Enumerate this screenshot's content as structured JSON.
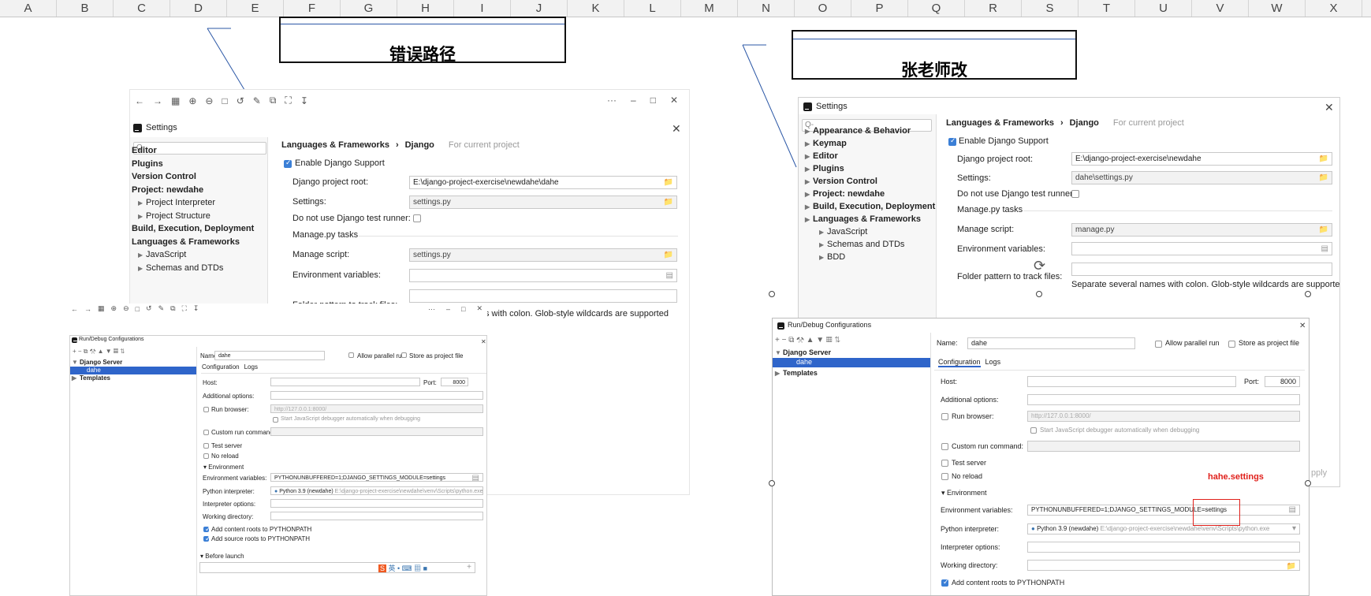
{
  "columns": [
    "A",
    "B",
    "C",
    "D",
    "E",
    "F",
    "G",
    "H",
    "I",
    "J",
    "K",
    "L",
    "M",
    "N",
    "O",
    "P",
    "Q",
    "R",
    "S",
    "T",
    "U",
    "V",
    "W",
    "X"
  ],
  "callouts": {
    "left": "错误路径",
    "right": "张老师改"
  },
  "left_settings": {
    "title": "Settings",
    "search_placeholder": "Q-",
    "breadcrumb": {
      "section": "Languages & Frameworks",
      "page": "Django",
      "scope": "For current project"
    },
    "tree": [
      {
        "label": "Editor",
        "bold": true
      },
      {
        "label": "Plugins",
        "bold": true
      },
      {
        "label": "Version Control",
        "bold": true
      },
      {
        "label": "Project: newdahe",
        "bold": true
      },
      {
        "label": "Project Interpreter",
        "bold": false
      },
      {
        "label": "Project Structure",
        "bold": false
      },
      {
        "label": "Build, Execution, Deployment",
        "bold": true
      },
      {
        "label": "Languages & Frameworks",
        "bold": true
      },
      {
        "label": "JavaScript",
        "bold": false
      },
      {
        "label": "Schemas and DTDs",
        "bold": false
      }
    ],
    "enable_label": "Enable Django Support",
    "project_root_label": "Django project root:",
    "project_root_value": "E:\\django-project-exercise\\newdahe\\dahe",
    "settings_label": "Settings:",
    "settings_value": "settings.py",
    "no_test_runner_label": "Do not use Django test runner:",
    "manage_tasks": "Manage.py tasks",
    "manage_script_label": "Manage script:",
    "manage_script_value": "settings.py",
    "env_vars_label": "Environment variables:",
    "folder_pattern_label": "Folder pattern to track files:",
    "hint": "s with colon. Glob-style wildcards are supported"
  },
  "left_rundebug": {
    "title": "Run/Debug Configurations",
    "name_label": "Name:",
    "name_value": "dahe",
    "allow_parallel": "Allow parallel run",
    "store_as_file": "Store as project file",
    "tree_server": "Django Server",
    "tree_dahe": "dahe",
    "tree_templates": "Templates",
    "tab_config": "Configuration",
    "tab_logs": "Logs",
    "host": "Host:",
    "port": "Port:",
    "port_value": "8000",
    "additional": "Additional options:",
    "run_browser": "Run browser:",
    "run_browser_url": "http://127.0.0.1:8000/",
    "js_debugger": "Start JavaScript debugger automatically when debugging",
    "custom_cmd": "Custom run command:",
    "test_server": "Test server",
    "no_reload": "No reload",
    "environment": "Environment",
    "env_vars": "Environment variables:",
    "env_vars_value": "PYTHONUNBUFFERED=1;DJANGO_SETTINGS_MODULE=settings",
    "py_interp": "Python interpreter:",
    "py_interp_value": "Python 3.9 (newdahe)",
    "py_interp_path": "E:\\django-project-exercise\\newdahe\\venv\\Scripts\\python.exe",
    "interp_opts": "Interpreter options:",
    "work_dir": "Working directory:",
    "add_content": "Add content roots to PYTHONPATH",
    "add_source": "Add source roots to PYTHONPATH",
    "before_launch": "Before launch"
  },
  "right_settings": {
    "title": "Settings",
    "search_placeholder": "Q-",
    "breadcrumb": {
      "section": "Languages & Frameworks",
      "page": "Django",
      "scope": "For current project"
    },
    "tree": [
      {
        "label": "Appearance & Behavior",
        "bold": true
      },
      {
        "label": "Keymap",
        "bold": true
      },
      {
        "label": "Editor",
        "bold": true
      },
      {
        "label": "Plugins",
        "bold": true
      },
      {
        "label": "Version Control",
        "bold": true
      },
      {
        "label": "Project: newdahe",
        "bold": true
      },
      {
        "label": "Build, Execution, Deployment",
        "bold": true
      },
      {
        "label": "Languages & Frameworks",
        "bold": true
      },
      {
        "label": "JavaScript",
        "bold": false
      },
      {
        "label": "Schemas and DTDs",
        "bold": false
      },
      {
        "label": "BDD",
        "bold": false
      }
    ],
    "enable_label": "Enable Django Support",
    "project_root_label": "Django project root:",
    "project_root_value": "E:\\django-project-exercise\\newdahe",
    "settings_label": "Settings:",
    "settings_value": "dahe\\settings.py",
    "no_test_runner_label": "Do not use Django test runner:",
    "manage_tasks": "Manage.py tasks",
    "manage_script_label": "Manage script:",
    "manage_script_value": "manage.py",
    "env_vars_label": "Environment variables:",
    "folder_pattern_label": "Folder pattern to track files:",
    "hint": "Separate several names with colon. Glob-style wildcards are supported",
    "apply_partial": "pply"
  },
  "right_rundebug": {
    "title": "Run/Debug Configurations",
    "name_label": "Name:",
    "name_value": "dahe",
    "allow_parallel": "Allow parallel run",
    "store_as_file": "Store as project file",
    "tree_server": "Django Server",
    "tree_dahe": "dahe",
    "tree_templates": "Templates",
    "tab_config": "Configuration",
    "tab_logs": "Logs",
    "host": "Host:",
    "port": "Port:",
    "port_value": "8000",
    "additional": "Additional options:",
    "run_browser": "Run browser:",
    "run_browser_url": "http://127.0.0.1:8000/",
    "js_debugger": "Start JavaScript debugger automatically when debugging",
    "custom_cmd": "Custom run command:",
    "test_server": "Test server",
    "no_reload": "No reload",
    "environment": "Environment",
    "env_vars": "Environment variables:",
    "env_vars_value": "PYTHONUNBUFFERED=1;DJANGO_SETTINGS_MODULE=settings",
    "py_interp": "Python interpreter:",
    "py_interp_value": "Python 3.9 (newdahe)",
    "py_interp_path": "E:\\django-project-exercise\\newdahe\\venv\\Scripts\\python.exe",
    "interp_opts": "Interpreter options:",
    "work_dir": "Working directory:",
    "add_content": "Add content roots to PYTHONPATH",
    "annotation": "hahe.settings"
  },
  "colors": {
    "accent": "#2f65ca",
    "annotation_red": "#e0201b",
    "callout_line": "#2b57a6"
  }
}
